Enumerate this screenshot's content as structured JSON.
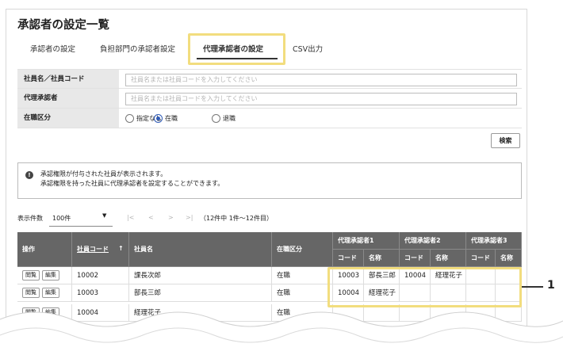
{
  "page": {
    "title": "承認者の設定一覧"
  },
  "tabs": [
    {
      "label": "承認者の設定"
    },
    {
      "label": "負担部門の承認者設定"
    },
    {
      "label": "代理承認者の設定"
    },
    {
      "label": "CSV出力"
    }
  ],
  "search": {
    "employee_label": "社員名／社員コード",
    "employee_placeholder": "社員名または社員コードを入力してください",
    "proxy_label": "代理承認者",
    "proxy_placeholder": "社員名または社員コードを入力してください",
    "status_label": "在職区分",
    "status_options": [
      {
        "label": "指定なし",
        "selected": false
      },
      {
        "label": "在職",
        "selected": true
      },
      {
        "label": "退職",
        "selected": false
      }
    ],
    "search_button": "検索"
  },
  "info": {
    "line1": "承認権限が付与された社員が表示されます。",
    "line2": "承認権限を持った社員に代理承認者を設定することができます。"
  },
  "pager": {
    "per_page_label": "表示件数",
    "per_page_value": "100件",
    "first": "|<",
    "prev": "<",
    "next": ">",
    "last": ">|",
    "summary": "（12件中 1件～12件目）"
  },
  "table": {
    "headers": {
      "action": "操作",
      "code": "社員コード",
      "sort": "↑",
      "name": "社員名",
      "status": "在職区分",
      "proxy1": "代理承認者1",
      "proxy2": "代理承認者2",
      "proxy3": "代理承認者3",
      "sub_code": "コード",
      "sub_name": "名称"
    },
    "btn_view": "閲覧",
    "btn_edit": "編集",
    "rows": [
      {
        "code": "10002",
        "name": "課長次郎",
        "status": "在職",
        "p1_code": "10003",
        "p1_name": "部長三郎",
        "p2_code": "10004",
        "p2_name": "経理花子",
        "p3_code": "",
        "p3_name": ""
      },
      {
        "code": "10003",
        "name": "部長三郎",
        "status": "在職",
        "p1_code": "10004",
        "p1_name": "経理花子",
        "p2_code": "",
        "p2_name": "",
        "p3_code": "",
        "p3_name": ""
      },
      {
        "code": "10004",
        "name": "経理花子",
        "status": "在職",
        "p1_code": "",
        "p1_name": "",
        "p2_code": "",
        "p2_name": "",
        "p3_code": "",
        "p3_name": ""
      }
    ]
  },
  "callout": {
    "number": "1"
  }
}
